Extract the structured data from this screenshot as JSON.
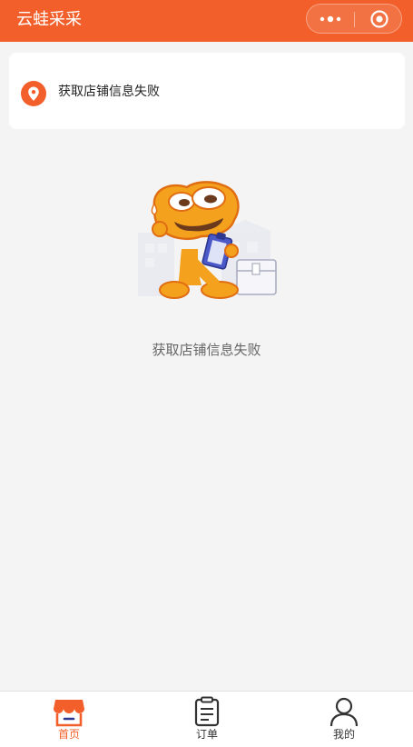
{
  "header": {
    "title": "云蛙采采",
    "background_color": "#f25f2a",
    "more_icon": "more-dots-icon",
    "close_icon": "target-circle-icon"
  },
  "store": {
    "icon": "location-pin-icon",
    "message": "获取店铺信息失败"
  },
  "empty_state": {
    "illustration": "frog-mascot-with-clipboard",
    "message": "获取店铺信息失败"
  },
  "tabbar": {
    "tabs": [
      {
        "label": "首页",
        "icon": "store-icon",
        "active": true
      },
      {
        "label": "订单",
        "icon": "clipboard-icon",
        "active": false
      },
      {
        "label": "我的",
        "icon": "user-icon",
        "active": false
      }
    ],
    "active_color": "#f25f2a"
  }
}
